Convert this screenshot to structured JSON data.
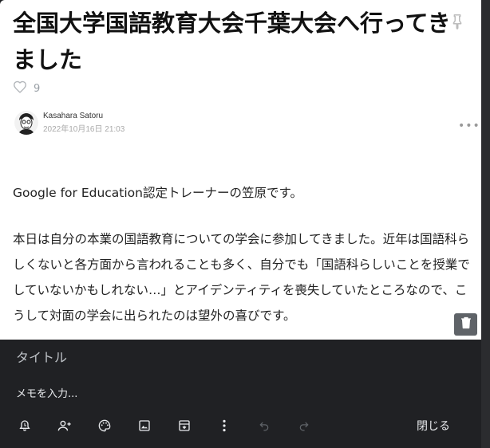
{
  "article": {
    "title": "全国大学国語教育大会千葉大会へ行ってきました",
    "like_count": "9",
    "author_name": "Kasahara Satoru",
    "published": "2022年10月16日 21:03",
    "paragraphs": [
      "Google for Education認定トレーナーの笠原です。",
      "本日は自分の本業の国語教育についての学会に参加してきました。近年は国語科らしくないと各方面から言われることも多く、自分でも「国語科らしいことを授業でしていないかもしれない…」とアイデンティティを喪失していたところなので、こうして対面の学会に出られたのは望外の喜びです。"
    ]
  },
  "note": {
    "title_placeholder": "タイトル",
    "body_placeholder": "メモを入力...",
    "close_label": "閉じる",
    "toolbar_icons": [
      "reminder-icon",
      "collaborator-icon",
      "palette-icon",
      "image-icon",
      "archive-icon",
      "more-vert-icon",
      "undo-icon",
      "redo-icon"
    ]
  },
  "colors": {
    "panel_bg": "#202124",
    "panel_text": "#e8eaed",
    "muted": "#9aa0a6"
  }
}
